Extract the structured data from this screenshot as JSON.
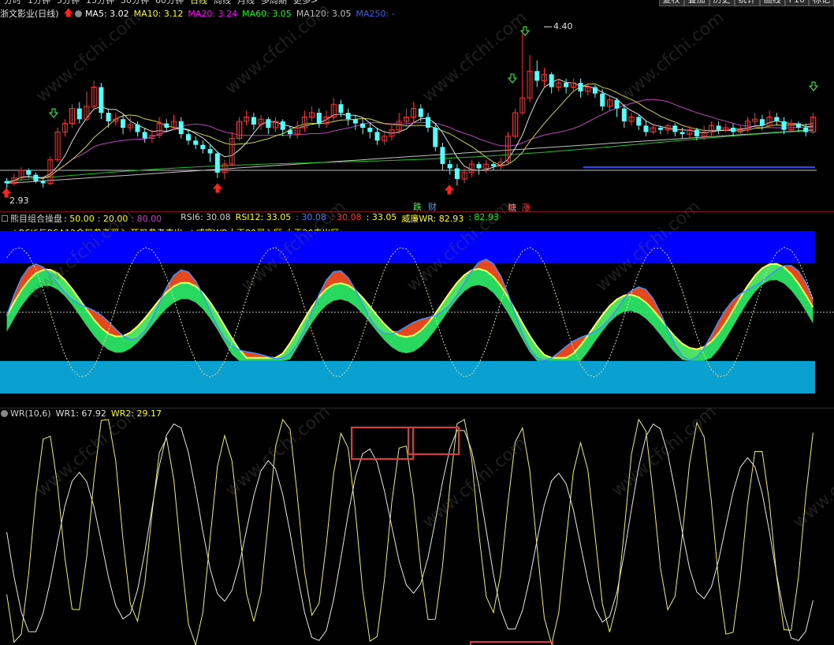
{
  "toolbar": {
    "tabs": [
      "分时",
      "1分钟",
      "5分钟",
      "15分钟",
      "30分钟",
      "60分钟",
      "日线",
      "周线",
      "月线",
      "多周期",
      "更多>"
    ],
    "active_tab": "日线",
    "right_buttons": [
      "复权",
      "叠加",
      "历史",
      "统计",
      "画线",
      "F10",
      "标记"
    ]
  },
  "price_panel": {
    "stock_title": "浙文影业(日线)",
    "ma": [
      {
        "label": "MA5: 3.02",
        "color": "#ffffff"
      },
      {
        "label": "MA10: 3.12",
        "color": "#ffff00"
      },
      {
        "label": "MA20: 3.24",
        "color": "#ff00ff"
      },
      {
        "label": "MA60: 3.05",
        "color": "#00ff00"
      },
      {
        "label": "MA120: 3.05",
        "color": "#c0c0c0"
      },
      {
        "label": "MA250: -",
        "color": "#3a5aff"
      }
    ],
    "high_label": "4.40",
    "low_label": "2.93",
    "tag_die": "跌",
    "tag_cai": "财",
    "tag_zhe": "糖",
    "tag_zhang": "涨"
  },
  "indicator_panel": {
    "name": "熊目组合操盘",
    "levels": [
      {
        "label": "50.00",
        "color": "#ffff00"
      },
      {
        "label": "20.00",
        "color": "#ffff00"
      },
      {
        "label": "80.00",
        "color": "#c040c0"
      }
    ],
    "values": [
      {
        "label": "RSI6: 30.08",
        "color": "#d0d0d0"
      },
      {
        "label": "RSI12: 33.05",
        "color": "#ffff00"
      },
      {
        "label": ": 30.08",
        "color": "#4080ff"
      },
      {
        "label": ": 30.08",
        "color": "#ff3030"
      },
      {
        "label": ": 33.05",
        "color": "#ffff00"
      },
      {
        "label": "威廉WR: 82.93",
        "color": "#ffff00"
      },
      {
        "label": ": 82.93",
        "color": "#00ff00"
      }
    ],
    "note": "★RSI6与RSA12金叉参考买入,死叉参考卖出. ★威廉WR大于80买入区,小于20卖出区."
  },
  "wr_panel": {
    "name": "WR(10,6)",
    "wr1": "WR1: 67.92",
    "wr2": "WR2: 29.17"
  },
  "watermark": "www.cfchi.com",
  "chart_data": [
    {
      "type": "candlestick",
      "title": "浙文影业(日线)",
      "ma_series": [
        "MA5",
        "MA10",
        "MA20",
        "MA60",
        "MA120",
        "MA250"
      ],
      "annotations": [
        "4.40",
        "2.93"
      ],
      "colors": {
        "up": "#ff3232",
        "down": "#54ffff"
      },
      "candles": [
        [
          3.02,
          3.0,
          3.05,
          2.93
        ],
        [
          3.0,
          3.05,
          3.09,
          2.98
        ],
        [
          3.05,
          3.12,
          3.15,
          3.02
        ],
        [
          3.12,
          3.08,
          3.14,
          3.05
        ],
        [
          3.08,
          3.02,
          3.1,
          3.0
        ],
        [
          3.02,
          3.0,
          3.04,
          2.96
        ],
        [
          3.0,
          3.22,
          3.25,
          2.98
        ],
        [
          3.22,
          3.48,
          3.52,
          3.2
        ],
        [
          3.48,
          3.56,
          3.6,
          3.44
        ],
        [
          3.56,
          3.7,
          3.74,
          3.52
        ],
        [
          3.7,
          3.6,
          3.76,
          3.56
        ],
        [
          3.6,
          3.72,
          3.86,
          3.58
        ],
        [
          3.72,
          3.9,
          3.96,
          3.68
        ],
        [
          3.9,
          3.66,
          3.94,
          3.6
        ],
        [
          3.66,
          3.58,
          3.7,
          3.52
        ],
        [
          3.58,
          3.6,
          3.66,
          3.54
        ],
        [
          3.6,
          3.52,
          3.64,
          3.46
        ],
        [
          3.52,
          3.55,
          3.62,
          3.48
        ],
        [
          3.55,
          3.48,
          3.58,
          3.44
        ],
        [
          3.48,
          3.42,
          3.52,
          3.38
        ],
        [
          3.42,
          3.45,
          3.5,
          3.38
        ],
        [
          3.45,
          3.56,
          3.62,
          3.42
        ],
        [
          3.56,
          3.52,
          3.6,
          3.48
        ],
        [
          3.52,
          3.58,
          3.64,
          3.5
        ],
        [
          3.58,
          3.46,
          3.62,
          3.42
        ],
        [
          3.46,
          3.4,
          3.5,
          3.36
        ],
        [
          3.4,
          3.36,
          3.44,
          3.32
        ],
        [
          3.36,
          3.32,
          3.4,
          3.28
        ],
        [
          3.32,
          3.28,
          3.36,
          3.2
        ],
        [
          3.28,
          3.1,
          3.3,
          3.05
        ],
        [
          3.1,
          3.18,
          3.22,
          3.04
        ],
        [
          3.18,
          3.42,
          3.48,
          3.16
        ],
        [
          3.42,
          3.58,
          3.62,
          3.4
        ],
        [
          3.58,
          3.62,
          3.68,
          3.54
        ],
        [
          3.62,
          3.55,
          3.66,
          3.5
        ],
        [
          3.55,
          3.6,
          3.64,
          3.5
        ],
        [
          3.6,
          3.52,
          3.62,
          3.46
        ],
        [
          3.52,
          3.58,
          3.62,
          3.48
        ],
        [
          3.58,
          3.5,
          3.6,
          3.44
        ],
        [
          3.5,
          3.46,
          3.54,
          3.42
        ],
        [
          3.46,
          3.52,
          3.58,
          3.42
        ],
        [
          3.52,
          3.62,
          3.68,
          3.48
        ],
        [
          3.62,
          3.66,
          3.72,
          3.58
        ],
        [
          3.66,
          3.56,
          3.7,
          3.52
        ],
        [
          3.56,
          3.62,
          3.68,
          3.52
        ],
        [
          3.62,
          3.74,
          3.8,
          3.58
        ],
        [
          3.74,
          3.66,
          3.78,
          3.62
        ],
        [
          3.66,
          3.6,
          3.7,
          3.54
        ],
        [
          3.6,
          3.56,
          3.64,
          3.5
        ],
        [
          3.56,
          3.52,
          3.6,
          3.46
        ],
        [
          3.52,
          3.48,
          3.56,
          3.42
        ],
        [
          3.48,
          3.4,
          3.52,
          3.36
        ],
        [
          3.4,
          3.44,
          3.5,
          3.36
        ],
        [
          3.44,
          3.5,
          3.56,
          3.4
        ],
        [
          3.5,
          3.58,
          3.66,
          3.46
        ],
        [
          3.58,
          3.62,
          3.7,
          3.54
        ],
        [
          3.62,
          3.7,
          3.76,
          3.56
        ],
        [
          3.7,
          3.62,
          3.74,
          3.58
        ],
        [
          3.62,
          3.52,
          3.66,
          3.48
        ],
        [
          3.52,
          3.34,
          3.56,
          3.3
        ],
        [
          3.34,
          3.18,
          3.38,
          3.12
        ],
        [
          3.18,
          3.14,
          3.22,
          3.08
        ],
        [
          3.14,
          3.04,
          3.18,
          2.98
        ],
        [
          3.04,
          3.1,
          3.14,
          3.0
        ],
        [
          3.1,
          3.18,
          3.22,
          3.06
        ],
        [
          3.18,
          3.14,
          3.2,
          3.08
        ],
        [
          3.14,
          3.18,
          3.22,
          3.1
        ],
        [
          3.18,
          3.16,
          3.2,
          3.12
        ],
        [
          3.16,
          3.2,
          3.24,
          3.12
        ],
        [
          3.2,
          3.44,
          3.48,
          3.18
        ],
        [
          3.44,
          3.66,
          3.7,
          3.42
        ],
        [
          3.66,
          3.8,
          4.4,
          3.64
        ],
        [
          3.8,
          4.05,
          4.2,
          3.76
        ],
        [
          4.05,
          3.96,
          4.15,
          3.9
        ],
        [
          3.96,
          4.02,
          4.08,
          3.9
        ],
        [
          4.02,
          3.9,
          4.04,
          3.84
        ],
        [
          3.9,
          3.94,
          3.98,
          3.86
        ],
        [
          3.94,
          3.9,
          3.98,
          3.84
        ],
        [
          3.9,
          3.94,
          3.98,
          3.86
        ],
        [
          3.94,
          3.86,
          3.98,
          3.8
        ],
        [
          3.86,
          3.9,
          3.94,
          3.82
        ],
        [
          3.9,
          3.84,
          3.92,
          3.8
        ],
        [
          3.84,
          3.72,
          3.88,
          3.68
        ],
        [
          3.72,
          3.78,
          3.82,
          3.68
        ],
        [
          3.78,
          3.7,
          3.8,
          3.62
        ],
        [
          3.7,
          3.58,
          3.74,
          3.52
        ],
        [
          3.58,
          3.62,
          3.66,
          3.54
        ],
        [
          3.62,
          3.54,
          3.64,
          3.5
        ],
        [
          3.54,
          3.48,
          3.58,
          3.44
        ],
        [
          3.48,
          3.52,
          3.56,
          3.46
        ],
        [
          3.52,
          3.5,
          3.54,
          3.46
        ],
        [
          3.5,
          3.54,
          3.56,
          3.46
        ],
        [
          3.54,
          3.48,
          3.56,
          3.44
        ],
        [
          3.48,
          3.46,
          3.52,
          3.42
        ],
        [
          3.46,
          3.5,
          3.54,
          3.42
        ],
        [
          3.5,
          3.44,
          3.52,
          3.4
        ],
        [
          3.44,
          3.48,
          3.54,
          3.4
        ],
        [
          3.48,
          3.54,
          3.58,
          3.44
        ],
        [
          3.54,
          3.5,
          3.58,
          3.46
        ],
        [
          3.5,
          3.52,
          3.56,
          3.48
        ],
        [
          3.52,
          3.48,
          3.56,
          3.44
        ],
        [
          3.48,
          3.5,
          3.54,
          3.46
        ],
        [
          3.5,
          3.58,
          3.62,
          3.48
        ],
        [
          3.58,
          3.6,
          3.66,
          3.54
        ],
        [
          3.6,
          3.54,
          3.64,
          3.5
        ],
        [
          3.54,
          3.62,
          3.68,
          3.52
        ],
        [
          3.62,
          3.58,
          3.66,
          3.54
        ],
        [
          3.58,
          3.5,
          3.62,
          3.46
        ],
        [
          3.5,
          3.56,
          3.6,
          3.48
        ],
        [
          3.56,
          3.52,
          3.58,
          3.48
        ],
        [
          3.52,
          3.48,
          3.56,
          3.44
        ],
        [
          3.48,
          3.62,
          3.66,
          3.46
        ]
      ]
    },
    {
      "type": "line",
      "title": "熊目组合操盘",
      "series": [
        {
          "name": "RSI6"
        },
        {
          "name": "RSI12"
        },
        {
          "name": "威廉WR"
        }
      ],
      "reference_lines": [
        20,
        50,
        80
      ],
      "zones": {
        "sell_top": [
          80,
          100
        ],
        "buy_bottom": [
          0,
          20
        ]
      }
    },
    {
      "type": "line",
      "title": "WR(10,6)",
      "series": [
        {
          "name": "WR1",
          "color": "#ffffff"
        },
        {
          "name": "WR2",
          "color": "#ffff00"
        }
      ]
    }
  ]
}
